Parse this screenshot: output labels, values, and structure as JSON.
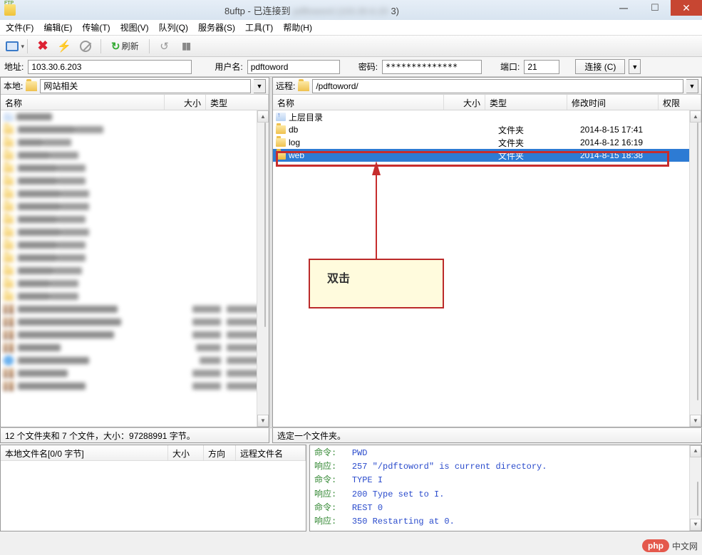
{
  "titlebar": {
    "app_title": "8uftp - 已连接到",
    "app_title_suffix": "3)"
  },
  "menu": {
    "file": "文件(F)",
    "edit": "编辑(E)",
    "transfer": "传输(T)",
    "view": "视图(V)",
    "queue": "队列(Q)",
    "server": "服务器(S)",
    "tools": "工具(T)",
    "help": "帮助(H)"
  },
  "toolbar": {
    "refresh_label": "刷新"
  },
  "connbar": {
    "host_label": "地址:",
    "host_value": "103.30.6.203",
    "user_label": "用户名:",
    "user_value": "pdftoword",
    "pass_label": "密码:",
    "pass_value": "**************",
    "port_label": "端口:",
    "port_value": "21",
    "connect_label": "连接 (C)"
  },
  "local": {
    "label": "本地:",
    "path_value": "网站相关",
    "cols": {
      "name": "名称",
      "size": "大小",
      "type": "类型"
    },
    "status": "12 个文件夹和 7 个文件，大小：97288991 字节。"
  },
  "remote": {
    "label": "远程:",
    "path_value": "/pdftoword/",
    "cols": {
      "name": "名称",
      "size": "大小",
      "type": "类型",
      "mtime": "修改时间",
      "perms": "权限"
    },
    "parent_dir": "上层目录",
    "rows": [
      {
        "name": "db",
        "type": "文件夹",
        "mtime": "2014-8-15 17:41"
      },
      {
        "name": "log",
        "type": "文件夹",
        "mtime": "2014-8-12 16:19"
      },
      {
        "name": "web",
        "type": "文件夹",
        "mtime": "2014-8-15 18:38"
      }
    ],
    "status": "选定一个文件夹。"
  },
  "annotation": {
    "double_click": "双击"
  },
  "queue": {
    "cols": {
      "name": "本地文件名[0/0 字节]",
      "size": "大小",
      "dir": "方向",
      "remote": "远程文件名"
    }
  },
  "log": {
    "cmd_label": "命令:",
    "resp_label": "响应:",
    "lines": [
      {
        "kind": "cmd",
        "text": "PWD"
      },
      {
        "kind": "resp",
        "text": "257 \"/pdftoword\" is current directory."
      },
      {
        "kind": "cmd",
        "text": "TYPE I"
      },
      {
        "kind": "resp",
        "text": "200 Type set to I."
      },
      {
        "kind": "cmd",
        "text": "REST 0"
      },
      {
        "kind": "resp",
        "text": "350 Restarting at 0."
      }
    ]
  },
  "watermark": {
    "pill": "php",
    "text": "中文网"
  }
}
